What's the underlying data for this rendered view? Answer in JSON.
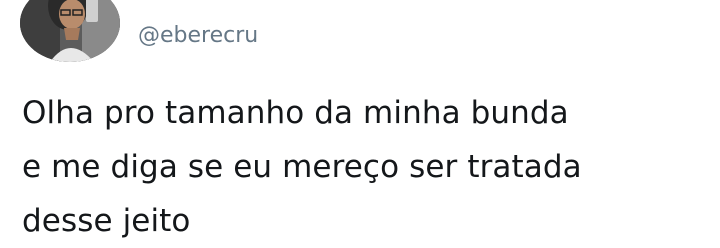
{
  "tweet": {
    "author_handle": "@eberecru",
    "avatar_icon": "user-avatar-photo",
    "text_lines": [
      "Olha pro tamanho da minha bunda",
      "e me diga se eu mereço ser tratada",
      "desse jeito"
    ]
  },
  "colors": {
    "handle": "#657786",
    "text": "#14171a",
    "background": "#ffffff"
  }
}
